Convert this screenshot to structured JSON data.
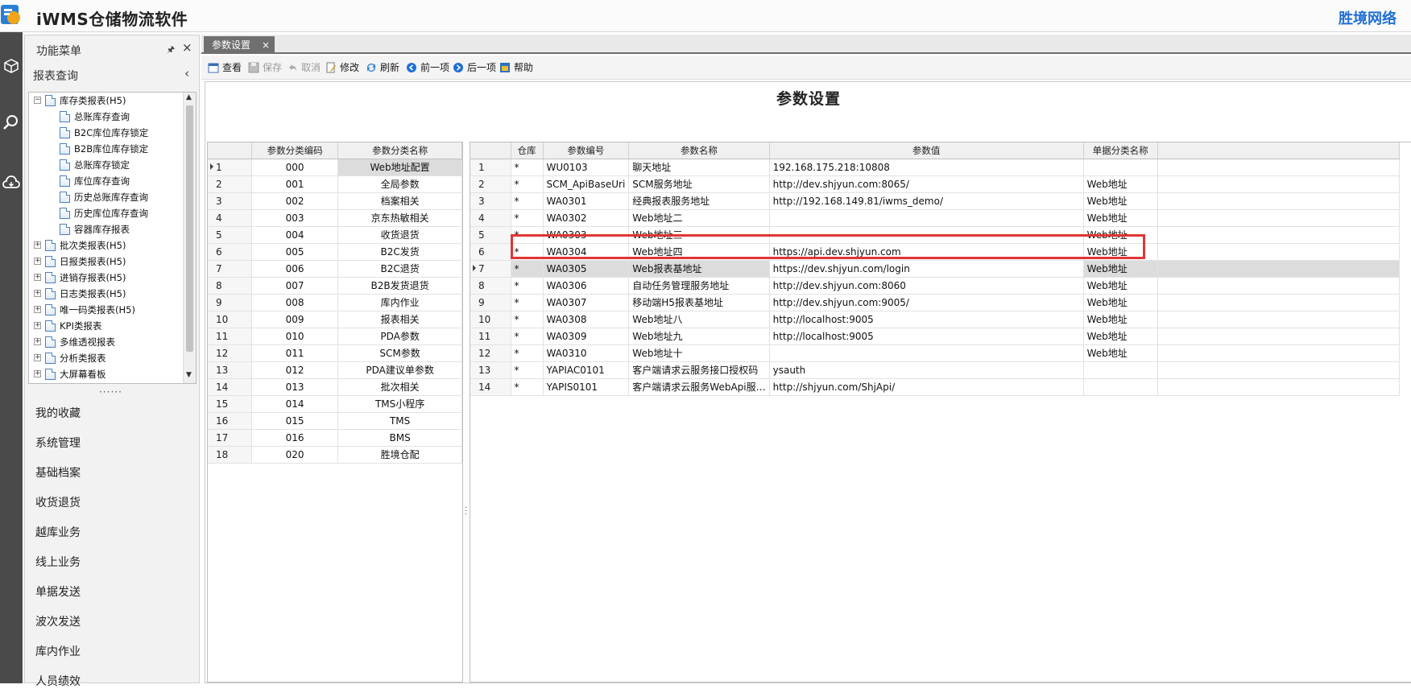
{
  "app": {
    "title": "iWMS仓储物流软件",
    "brand": "胜境网络"
  },
  "sidebar": {
    "title": "功能菜单",
    "pin_icon": "pin-icon",
    "close_glyph": "×",
    "section": "报表查询",
    "tree": [
      {
        "label": "库存类报表(H5)",
        "level": 0,
        "expanded": true
      },
      {
        "label": "总账库存查询",
        "level": 1
      },
      {
        "label": "B2C库位库存锁定",
        "level": 1
      },
      {
        "label": "B2B库位库存锁定",
        "level": 1
      },
      {
        "label": "总账库存锁定",
        "level": 1
      },
      {
        "label": "库位库存查询",
        "level": 1
      },
      {
        "label": "历史总账库存查询",
        "level": 1
      },
      {
        "label": "历史库位库存查询",
        "level": 1
      },
      {
        "label": "容器库存报表",
        "level": 1
      },
      {
        "label": "批次类报表(H5)",
        "level": 0,
        "expanded": false
      },
      {
        "label": "日报类报表(H5)",
        "level": 0,
        "expanded": false
      },
      {
        "label": "进销存报表(H5)",
        "level": 0,
        "expanded": false
      },
      {
        "label": "日志类报表(H5)",
        "level": 0,
        "expanded": false
      },
      {
        "label": "唯一码类报表(H5)",
        "level": 0,
        "expanded": false
      },
      {
        "label": "KPI类报表",
        "level": 0,
        "expanded": false
      },
      {
        "label": "多维透视报表",
        "level": 0,
        "expanded": false
      },
      {
        "label": "分析类报表",
        "level": 0,
        "expanded": false
      },
      {
        "label": "大屏幕看板",
        "level": 0,
        "expanded": false
      }
    ],
    "menu": [
      "我的收藏",
      "系统管理",
      "基础档案",
      "收货退货",
      "越库业务",
      "线上业务",
      "单据发送",
      "波次发送",
      "库内作业",
      "人员绩效"
    ]
  },
  "tab": {
    "label": "参数设置",
    "close": "×"
  },
  "toolbar": [
    {
      "name": "view",
      "label": "查看",
      "icon": "calendar-icon",
      "enabled": true
    },
    {
      "name": "save",
      "label": "保存",
      "icon": "save-icon",
      "enabled": false
    },
    {
      "name": "cancel",
      "label": "取消",
      "icon": "undo-icon",
      "enabled": false
    },
    {
      "name": "edit",
      "label": "修改",
      "icon": "edit-icon",
      "enabled": true
    },
    {
      "name": "refresh",
      "label": "刷新",
      "icon": "refresh-icon",
      "enabled": true
    },
    {
      "name": "prev",
      "label": "前一项",
      "icon": "arrow-left-icon",
      "enabled": true
    },
    {
      "name": "next",
      "label": "后一项",
      "icon": "arrow-right-icon",
      "enabled": true
    },
    {
      "name": "help",
      "label": "帮助",
      "icon": "help-icon",
      "enabled": true
    }
  ],
  "page_title": "参数设置",
  "left_grid": {
    "columns": [
      "",
      "参数分类编码",
      "参数分类名称"
    ],
    "current_row": 0,
    "rows": [
      [
        "1",
        "000",
        "Web地址配置"
      ],
      [
        "2",
        "001",
        "全局参数"
      ],
      [
        "3",
        "002",
        "档案相关"
      ],
      [
        "4",
        "003",
        "京东热敏相关"
      ],
      [
        "5",
        "004",
        "收货退货"
      ],
      [
        "6",
        "005",
        "B2C发货"
      ],
      [
        "7",
        "006",
        "B2C退货"
      ],
      [
        "8",
        "007",
        "B2B发货退货"
      ],
      [
        "9",
        "008",
        "库内作业"
      ],
      [
        "10",
        "009",
        "报表相关"
      ],
      [
        "11",
        "010",
        "PDA参数"
      ],
      [
        "12",
        "011",
        "SCM参数"
      ],
      [
        "13",
        "012",
        "PDA建议单参数"
      ],
      [
        "14",
        "013",
        "批次相关"
      ],
      [
        "15",
        "014",
        "TMS小程序"
      ],
      [
        "16",
        "015",
        "TMS"
      ],
      [
        "17",
        "016",
        "BMS"
      ],
      [
        "18",
        "020",
        "胜境仓配"
      ]
    ]
  },
  "right_grid": {
    "columns": [
      "",
      "仓库",
      "参数编号",
      "参数名称",
      "参数值",
      "单据分类名称",
      ""
    ],
    "current_row": 6,
    "rows": [
      [
        "1",
        "*",
        "WU0103",
        "聊天地址",
        "192.168.175.218:10808",
        ""
      ],
      [
        "2",
        "*",
        "SCM_ApiBaseUri",
        "SCM服务地址",
        "http://dev.shjyun.com:8065/",
        "Web地址"
      ],
      [
        "3",
        "*",
        "WA0301",
        "经典报表服务地址",
        "http://192.168.149.81/iwms_demo/",
        "Web地址"
      ],
      [
        "4",
        "*",
        "WA0302",
        "Web地址二",
        "",
        "Web地址"
      ],
      [
        "5",
        "*",
        "WA0303",
        "Web地址三",
        "",
        "Web地址"
      ],
      [
        "6",
        "*",
        "WA0304",
        "Web地址四",
        "https://api.dev.shjyun.com",
        "Web地址"
      ],
      [
        "7",
        "*",
        "WA0305",
        "Web报表基地址",
        "https://dev.shjyun.com/login",
        "Web地址"
      ],
      [
        "8",
        "*",
        "WA0306",
        "自动任务管理服务地址",
        "http://dev.shjyun.com:8060",
        "Web地址"
      ],
      [
        "9",
        "*",
        "WA0307",
        "移动端H5报表基地址",
        "http://dev.shjyun.com:9005/",
        "Web地址"
      ],
      [
        "10",
        "*",
        "WA0308",
        "Web地址八",
        "http://localhost:9005",
        "Web地址"
      ],
      [
        "11",
        "*",
        "WA0309",
        "Web地址九",
        "http://localhost:9005",
        "Web地址"
      ],
      [
        "12",
        "*",
        "WA0310",
        "Web地址十",
        "",
        "Web地址"
      ],
      [
        "13",
        "*",
        "YAPIAC0101",
        "客户端请求云服务接口授权码",
        "ysauth",
        ""
      ],
      [
        "14",
        "*",
        "YAPIS0101",
        "客户端请求云服务WebApi服…",
        "http://shjyun.com/ShjApi/",
        ""
      ]
    ]
  },
  "colors": {
    "highlight": "#e23434",
    "tab_bg": "#6f6f6f",
    "iconbar_bg": "#4a4a4a",
    "brand": "#1f6fd6"
  }
}
